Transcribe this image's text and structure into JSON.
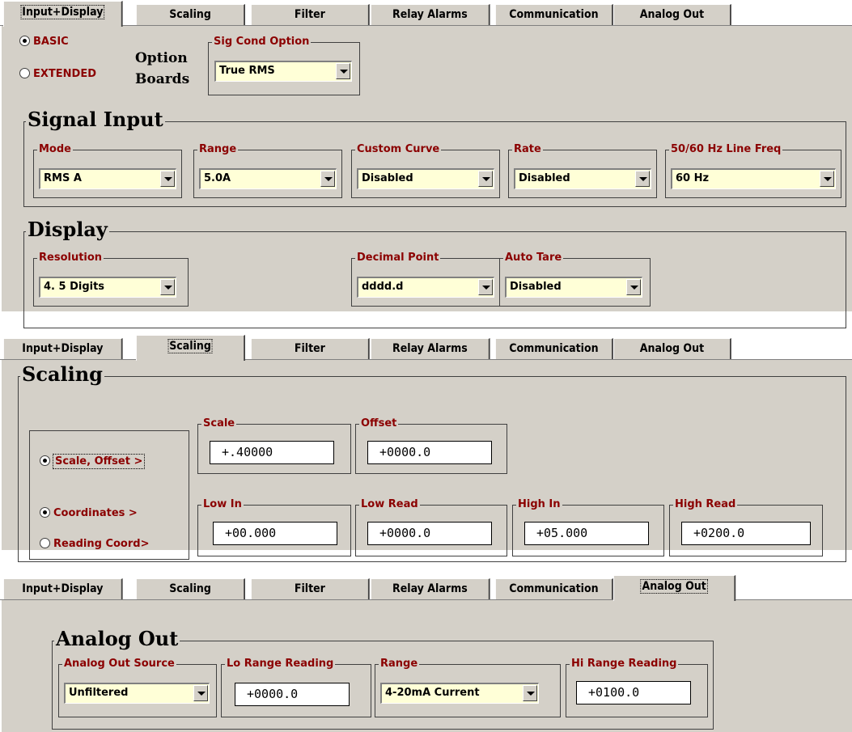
{
  "tabs": [
    "Input+Display",
    "Scaling",
    "Filter",
    "Relay Alarms",
    "Communication",
    "Analog Out"
  ],
  "panel1": {
    "active_tab": "Input+Display",
    "radio_basic": "BASIC",
    "radio_extended": "EXTENDED",
    "option_boards_line1": "Option",
    "option_boards_line2": "Boards",
    "sig_cond_option": {
      "label": "Sig Cond Option",
      "value": "True RMS"
    },
    "signal_input": {
      "title": "Signal Input",
      "mode": {
        "label": "Mode",
        "value": "RMS A"
      },
      "range": {
        "label": "Range",
        "value": "5.0A"
      },
      "custom_curve": {
        "label": "Custom Curve",
        "value": "Disabled"
      },
      "rate": {
        "label": "Rate",
        "value": "Disabled"
      },
      "line_freq": {
        "label": "50/60 Hz Line Freq",
        "value": "60 Hz"
      }
    },
    "display": {
      "title": "Display",
      "resolution": {
        "label": "Resolution",
        "value": "4. 5 Digits"
      },
      "decimal_point": {
        "label": "Decimal Point",
        "value": "dddd.d"
      },
      "auto_tare": {
        "label": "Auto Tare",
        "value": "Disabled"
      }
    }
  },
  "panel2": {
    "active_tab": "Scaling",
    "title": "Scaling",
    "radio_scale_offset": "Scale, Offset  >",
    "radio_coordinates": "Coordinates  >",
    "radio_reading_coord": "Reading Coord>",
    "scale": {
      "label": "Scale",
      "value": "+.40000"
    },
    "offset": {
      "label": "Offset",
      "value": "+0000.0"
    },
    "low_in": {
      "label": "Low In",
      "value": "+00.000"
    },
    "low_read": {
      "label": "Low Read",
      "value": "+0000.0"
    },
    "high_in": {
      "label": "High In",
      "value": "+05.000"
    },
    "high_read": {
      "label": "High Read",
      "value": "+0200.0"
    }
  },
  "panel3": {
    "active_tab": "Analog Out",
    "title": "Analog Out",
    "source": {
      "label": "Analog Out Source",
      "value": "Unfiltered"
    },
    "lo_range": {
      "label": "Lo Range Reading",
      "value": "+0000.0"
    },
    "range": {
      "label": "Range",
      "value": "4-20mA Current"
    },
    "hi_range": {
      "label": "Hi Range Reading",
      "value": "+0100.0"
    }
  }
}
